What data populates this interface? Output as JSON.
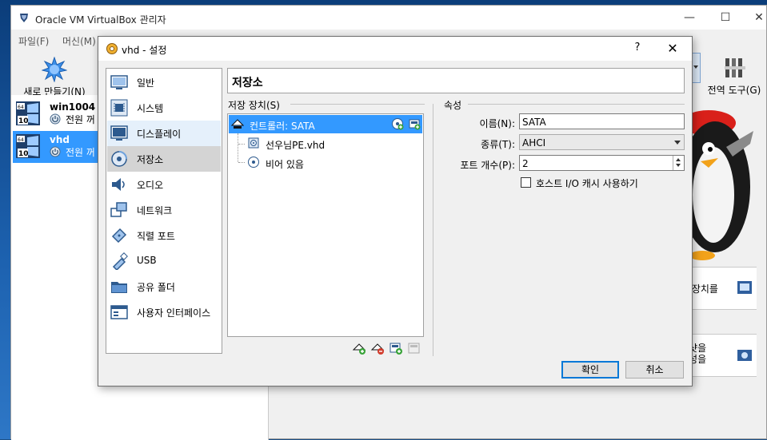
{
  "main_window": {
    "title": "Oracle VM VirtualBox 관리자",
    "menu": [
      "파일(F)",
      "머신(M)"
    ],
    "toolbar": {
      "new_label": "새로 만들기(N)",
      "global_tools_label": "전역 도구(G)"
    },
    "vms": [
      {
        "name": "win1004",
        "os_badge": "64",
        "os_ver": "10",
        "state": "전원 꺼"
      },
      {
        "name": "vhd",
        "os_badge": "64",
        "os_ver": "10",
        "state": "전원 꺼"
      }
    ],
    "side_cards": [
      {
        "text": "는 장치를"
      },
      {
        "text": "냅샷을\n생성을"
      }
    ]
  },
  "dialog": {
    "title": "vhd - 설정",
    "help": "?",
    "close": "✕",
    "nav": [
      {
        "label": "일반",
        "icon": "general-icon"
      },
      {
        "label": "시스템",
        "icon": "system-icon"
      },
      {
        "label": "디스플레이",
        "icon": "display-icon"
      },
      {
        "label": "저장소",
        "icon": "storage-icon"
      },
      {
        "label": "오디오",
        "icon": "audio-icon"
      },
      {
        "label": "네트워크",
        "icon": "network-icon"
      },
      {
        "label": "직렬 포트",
        "icon": "serial-port-icon"
      },
      {
        "label": "USB",
        "icon": "usb-icon"
      },
      {
        "label": "공유 폴더",
        "icon": "shared-folder-icon"
      },
      {
        "label": "사용자 인터페이스",
        "icon": "user-interface-icon"
      }
    ],
    "page_title": "저장소",
    "storage_devices_label": "저장 장치(S)",
    "tree": {
      "controller": "컨트롤러: SATA",
      "children": [
        "선우님PE.vhd",
        "비어 있음"
      ]
    },
    "attributes_label": "속성",
    "props": {
      "name_label": "이름(N):",
      "name_value": "SATA",
      "type_label": "종류(T):",
      "type_value": "AHCI",
      "ports_label": "포트 개수(P):",
      "ports_value": "2",
      "cache_label": "호스트 I/O 캐시 사용하기",
      "cache_checked": false
    },
    "ok_label": "확인",
    "cancel_label": "취소"
  }
}
